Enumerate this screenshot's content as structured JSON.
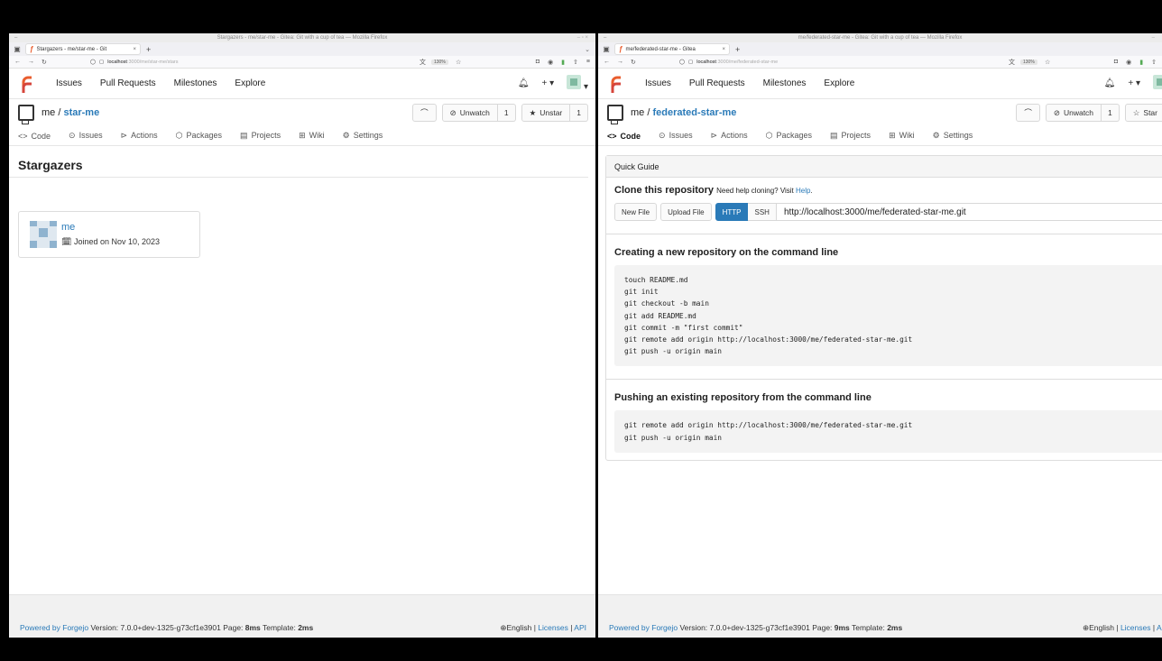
{
  "left": {
    "window_title": "Stargazers - me/star-me - Gitea: Git with a cup of tea — Mozilla Firefox",
    "tab_label": "Stargazers - me/star-me - Git",
    "url_host": "localhost",
    "url_path": ":3000/me/star-me/stars",
    "zoom": "130%",
    "nav": [
      "Issues",
      "Pull Requests",
      "Milestones",
      "Explore"
    ],
    "repo_owner": "me /",
    "repo_name": "star-me",
    "unwatch_label": "Unwatch",
    "watch_count": "1",
    "star_label": "Unstar",
    "star_count": "1",
    "tabs": [
      "Code",
      "Issues",
      "Actions",
      "Packages",
      "Projects",
      "Wiki",
      "Settings"
    ],
    "page_title": "Stargazers",
    "user_name": "me",
    "joined": "Joined on Nov 10, 2023",
    "footer_powered": "Powered by Forgejo",
    "footer_version": "Version: 7.0.0+dev-1325-g73cf1e3901 Page: ",
    "footer_page_ms": "8ms",
    "footer_template": " Template: ",
    "footer_template_ms": "2ms",
    "footer_lang": "English",
    "footer_licenses": "Licenses",
    "footer_api": "API"
  },
  "right": {
    "window_title": "me/federated-star-me - Gitea: Git with a cup of tea — Mozilla Firefox",
    "tab_label": "me/federated-star-me - Gitea",
    "url_host": "localhost",
    "url_path": ":3000/me/federated-star-me",
    "zoom": "130%",
    "nav": [
      "Issues",
      "Pull Requests",
      "Milestones",
      "Explore"
    ],
    "repo_owner": "me /",
    "repo_name": "federated-star-me",
    "unwatch_label": "Unwatch",
    "watch_count": "1",
    "star_label": "Star",
    "tabs": [
      "Code",
      "Issues",
      "Actions",
      "Packages",
      "Projects",
      "Wiki",
      "Settings"
    ],
    "quick_guide": "Quick Guide",
    "clone_title": "Clone this repository",
    "clone_help_prefix": "Need help cloning? Visit ",
    "clone_help_link": "Help",
    "new_file": "New File",
    "upload_file": "Upload File",
    "http": "HTTP",
    "ssh": "SSH",
    "clone_url": "http://localhost:3000/me/federated-star-me.git",
    "new_repo_title": "Creating a new repository on the command line",
    "new_repo_code": "touch README.md\ngit init\ngit checkout -b main\ngit add README.md\ngit commit -m \"first commit\"\ngit remote add origin http://localhost:3000/me/federated-star-me.git\ngit push -u origin main",
    "push_title": "Pushing an existing repository from the command line",
    "push_code": "git remote add origin http://localhost:3000/me/federated-star-me.git\ngit push -u origin main",
    "footer_powered": "Powered by Forgejo",
    "footer_version": "Version: 7.0.0+dev-1325-g73cf1e3901 Page: ",
    "footer_page_ms": "9ms",
    "footer_template": " Template: ",
    "footer_template_ms": "2ms",
    "footer_lang": "English",
    "footer_licenses": "Licenses",
    "footer_api": "AI"
  }
}
